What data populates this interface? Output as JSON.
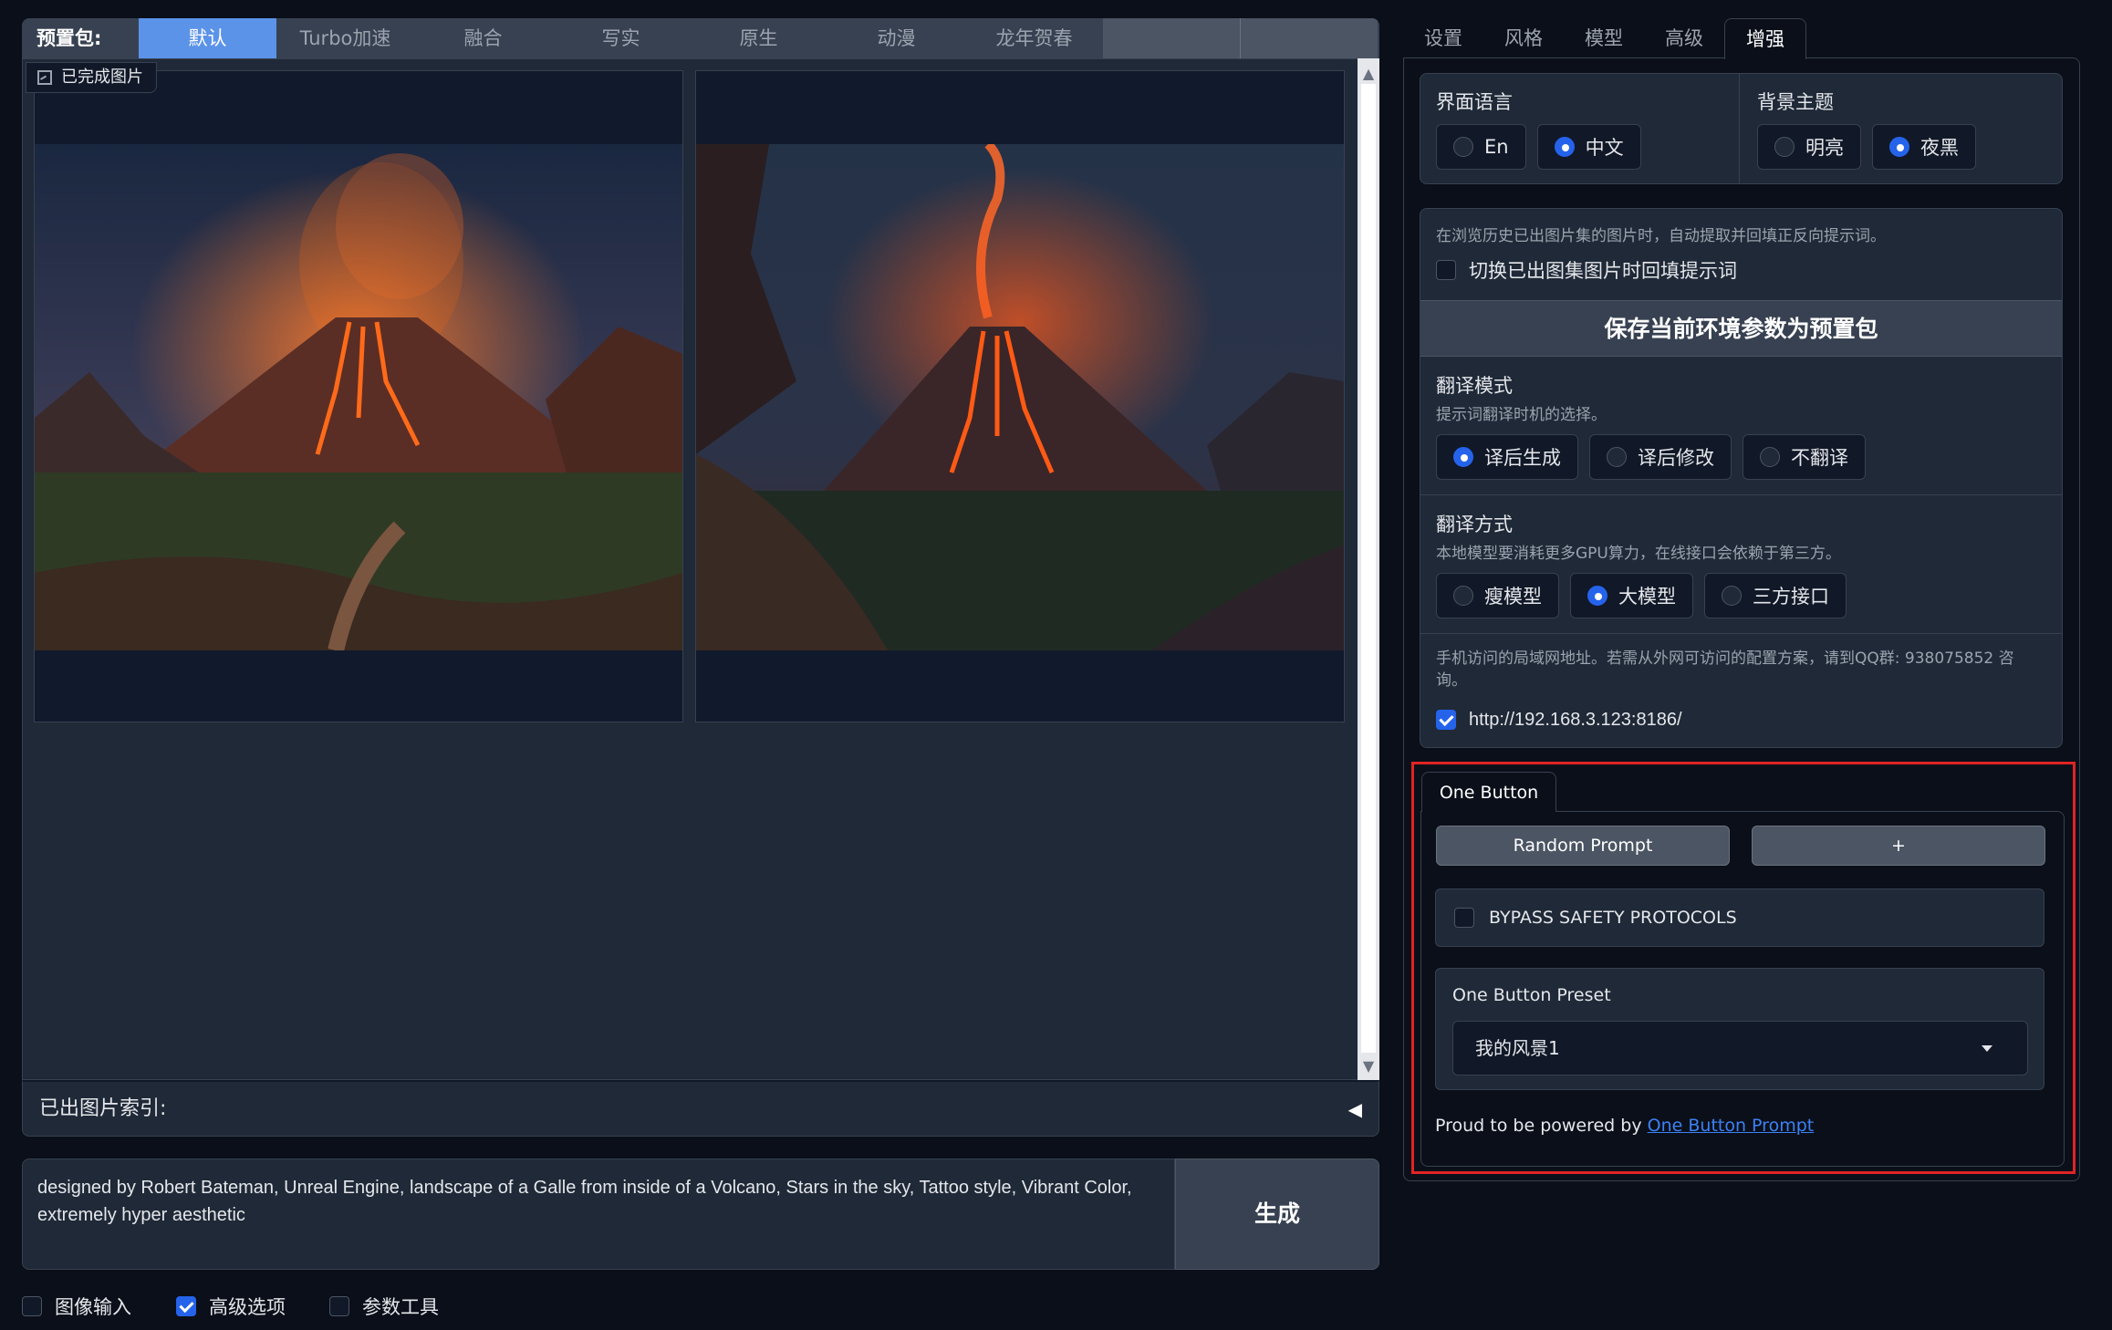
{
  "preset_bar": {
    "label": "预置包:",
    "tabs": [
      "默认",
      "Turbo加速",
      "融合",
      "写实",
      "原生",
      "动漫",
      "龙年贺春"
    ],
    "active_index": 0
  },
  "gallery": {
    "label": "已完成图片",
    "images": [
      {
        "alt": "volcano-landscape-1"
      },
      {
        "alt": "volcano-landscape-2"
      }
    ]
  },
  "index_bar": {
    "label": "已出图片索引:"
  },
  "prompt": {
    "text": "designed by Robert Bateman, Unreal Engine, landscape of a Galle from inside of a Volcano, Stars in the sky, Tattoo style, Vibrant Color, extremely hyper aesthetic"
  },
  "generate_button": "生成",
  "options": {
    "image_input": {
      "label": "图像输入",
      "checked": false
    },
    "advanced": {
      "label": "高级选项",
      "checked": true
    },
    "param_tools": {
      "label": "参数工具",
      "checked": false
    }
  },
  "right_tabs": {
    "tabs": [
      "设置",
      "风格",
      "模型",
      "高级",
      "增强"
    ],
    "active_index": 4
  },
  "ui_language": {
    "title": "界面语言",
    "options": [
      {
        "label": "En",
        "selected": false
      },
      {
        "label": "中文",
        "selected": true
      }
    ]
  },
  "bg_theme": {
    "title": "背景主题",
    "options": [
      {
        "label": "明亮",
        "selected": false
      },
      {
        "label": "夜黑",
        "selected": true
      }
    ]
  },
  "history_fill": {
    "info": "在浏览历史已出图片集的图片时，自动提取并回填正反向提示词。",
    "checkbox_label": "切换已出图集图片时回填提示词",
    "checked": false
  },
  "save_preset_button": "保存当前环境参数为预置包",
  "translate_mode": {
    "title": "翻译模式",
    "desc": "提示词翻译时机的选择。",
    "options": [
      {
        "label": "译后生成",
        "selected": true
      },
      {
        "label": "译后修改",
        "selected": false
      },
      {
        "label": "不翻译",
        "selected": false
      }
    ]
  },
  "translate_method": {
    "title": "翻译方式",
    "desc": "本地模型要消耗更多GPU算力，在线接口会依赖于第三方。",
    "options": [
      {
        "label": "瘦模型",
        "selected": false
      },
      {
        "label": "大模型",
        "selected": true
      },
      {
        "label": "三方接口",
        "selected": false
      }
    ]
  },
  "lan_access": {
    "info": "手机访问的局域网地址。若需从外网可访问的配置方案，请到QQ群: 938075852 咨询。",
    "url": "http://192.168.3.123:8186/",
    "checked": true
  },
  "one_button": {
    "tab": "One Button",
    "random_prompt": "Random Prompt",
    "plus": "+",
    "bypass_label": "BYPASS SAFETY PROTOCOLS",
    "bypass_checked": false,
    "preset_label": "One Button Preset",
    "preset_value": "我的风景1",
    "powered_prefix": "Proud to be powered by",
    "powered_link": "One Button Prompt"
  },
  "colors": {
    "accent": "#2563eb",
    "active_preset_tab": "#5b93e8",
    "highlight_border": "#e02424",
    "background": "#0b0f19"
  }
}
